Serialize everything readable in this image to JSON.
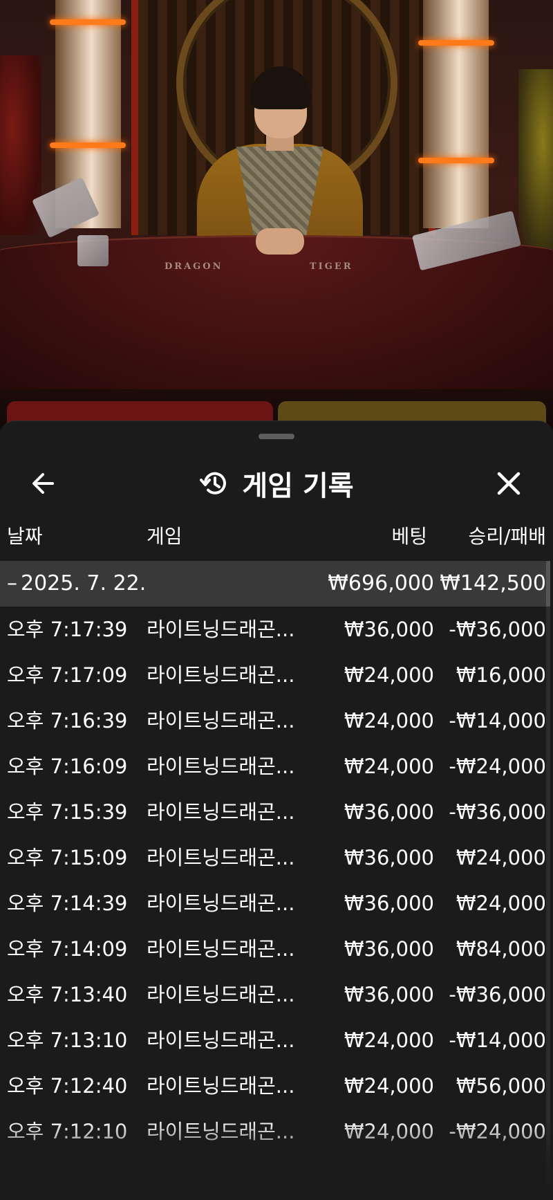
{
  "live_table": {
    "labels": [
      "DRAGON",
      "TIGER"
    ]
  },
  "history_panel": {
    "title": "게임 기록",
    "columns": {
      "date": "날짜",
      "game": "게임",
      "bet": "베팅",
      "result": "승리/패배"
    },
    "summary": {
      "toggle": "–",
      "date": "2025. 7. 22.",
      "total_bet": "₩696,000",
      "total_result": "₩142,500"
    },
    "rows": [
      {
        "time": "오후 7:17:39",
        "game": "라이트닝드래곤...",
        "bet": "₩36,000",
        "result": "-₩36,000"
      },
      {
        "time": "오후 7:17:09",
        "game": "라이트닝드래곤...",
        "bet": "₩24,000",
        "result": "₩16,000"
      },
      {
        "time": "오후 7:16:39",
        "game": "라이트닝드래곤...",
        "bet": "₩24,000",
        "result": "-₩14,000"
      },
      {
        "time": "오후 7:16:09",
        "game": "라이트닝드래곤...",
        "bet": "₩24,000",
        "result": "-₩24,000"
      },
      {
        "time": "오후 7:15:39",
        "game": "라이트닝드래곤...",
        "bet": "₩36,000",
        "result": "-₩36,000"
      },
      {
        "time": "오후 7:15:09",
        "game": "라이트닝드래곤...",
        "bet": "₩36,000",
        "result": "₩24,000"
      },
      {
        "time": "오후 7:14:39",
        "game": "라이트닝드래곤...",
        "bet": "₩36,000",
        "result": "₩24,000"
      },
      {
        "time": "오후 7:14:09",
        "game": "라이트닝드래곤...",
        "bet": "₩36,000",
        "result": "₩84,000"
      },
      {
        "time": "오후 7:13:40",
        "game": "라이트닝드래곤...",
        "bet": "₩36,000",
        "result": "-₩36,000"
      },
      {
        "time": "오후 7:13:10",
        "game": "라이트닝드래곤...",
        "bet": "₩24,000",
        "result": "-₩14,000"
      },
      {
        "time": "오후 7:12:40",
        "game": "라이트닝드래곤...",
        "bet": "₩24,000",
        "result": "₩56,000"
      },
      {
        "time": "오후 7:12:10",
        "game": "라이트닝드래곤...",
        "bet": "₩24,000",
        "result": "-₩24,000"
      }
    ]
  },
  "icons": {
    "back": "arrow-left-icon",
    "history": "history-clock-icon",
    "close": "close-icon"
  },
  "colors": {
    "sheet_bg": "#1b1b1b",
    "summary_bg": "#393939",
    "text": "#ffffff"
  }
}
